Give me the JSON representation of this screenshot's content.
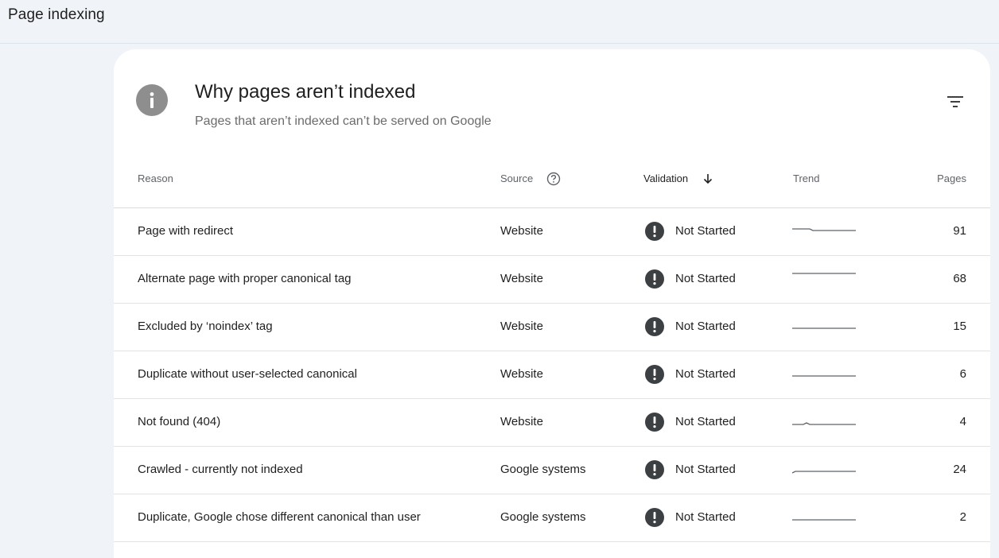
{
  "header": {
    "title": "Page indexing"
  },
  "card": {
    "title": "Why pages aren’t indexed",
    "subtitle": "Pages that aren’t indexed can’t be served on Google"
  },
  "table": {
    "columns": {
      "reason": "Reason",
      "source": "Source",
      "validation": "Validation",
      "trend": "Trend",
      "pages": "Pages"
    },
    "rows": [
      {
        "reason": "Page with redirect",
        "source": "Website",
        "validation": "Not Started",
        "pages": "91"
      },
      {
        "reason": "Alternate page with proper canonical tag",
        "source": "Website",
        "validation": "Not Started",
        "pages": "68"
      },
      {
        "reason": "Excluded by ‘noindex’ tag",
        "source": "Website",
        "validation": "Not Started",
        "pages": "15"
      },
      {
        "reason": "Duplicate without user-selected canonical",
        "source": "Website",
        "validation": "Not Started",
        "pages": "6"
      },
      {
        "reason": "Not found (404)",
        "source": "Website",
        "validation": "Not Started",
        "pages": "4"
      },
      {
        "reason": "Crawled - currently not indexed",
        "source": "Google systems",
        "validation": "Not Started",
        "pages": "24"
      },
      {
        "reason": "Duplicate, Google chose different canonical than user",
        "source": "Google systems",
        "validation": "Not Started",
        "pages": "2"
      }
    ]
  },
  "icons": {
    "info": "info-icon",
    "filter": "filter-icon",
    "help": "help-circle-icon",
    "sort": "arrow-down-icon",
    "status": "exclamation-circle-icon"
  },
  "colors": {
    "background": "#f0f4f9",
    "card": "#ffffff",
    "status_icon": "#3c4043",
    "trend_line": "#5f6368"
  }
}
